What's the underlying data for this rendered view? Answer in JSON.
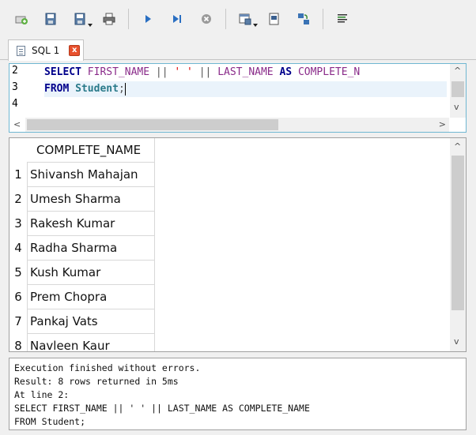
{
  "toolbar": {
    "buttons": [
      {
        "icon": "new-tab-icon"
      },
      {
        "icon": "open-sql-icon"
      },
      {
        "icon": "save-sql-icon",
        "dropdown": true
      },
      {
        "icon": "print-icon"
      },
      {
        "icon": "execute-all-icon"
      },
      {
        "icon": "execute-line-icon"
      },
      {
        "icon": "stop-icon"
      },
      {
        "icon": "save-results-icon",
        "dropdown": true
      },
      {
        "icon": "find-icon"
      },
      {
        "icon": "find-replace-icon"
      },
      {
        "icon": "wrap-lines-icon"
      }
    ]
  },
  "tab": {
    "label": "SQL 1",
    "close_glyph": "x"
  },
  "editor": {
    "line_numbers": [
      "2",
      "3",
      "4"
    ],
    "line2": {
      "kw_select": "SELECT",
      "col1": "FIRST_NAME",
      "op1": "||",
      "str": "' '",
      "op2": "||",
      "col2": "LAST_NAME",
      "kw_as": "AS",
      "alias": "COMPLETE_N"
    },
    "line3": {
      "kw_from": "FROM",
      "table": "Student",
      "semi": ";"
    }
  },
  "results": {
    "column": "COMPLETE_NAME",
    "rows": [
      {
        "n": "1",
        "name": "Shivansh Mahajan"
      },
      {
        "n": "2",
        "name": "Umesh Sharma"
      },
      {
        "n": "3",
        "name": "Rakesh Kumar"
      },
      {
        "n": "4",
        "name": "Radha Sharma"
      },
      {
        "n": "5",
        "name": "Kush Kumar"
      },
      {
        "n": "6",
        "name": "Prem Chopra"
      },
      {
        "n": "7",
        "name": "Pankaj Vats"
      },
      {
        "n": "8",
        "name": "Navleen Kaur"
      }
    ]
  },
  "messages": [
    "Execution finished without errors.",
    "Result: 8 rows returned in 5ms",
    "At line 2:",
    "SELECT FIRST_NAME || ' ' || LAST_NAME AS COMPLETE_NAME",
    "FROM Student;"
  ],
  "scroll_glyphs": {
    "up": "^",
    "down": "v",
    "left": "<",
    "right": ">"
  }
}
